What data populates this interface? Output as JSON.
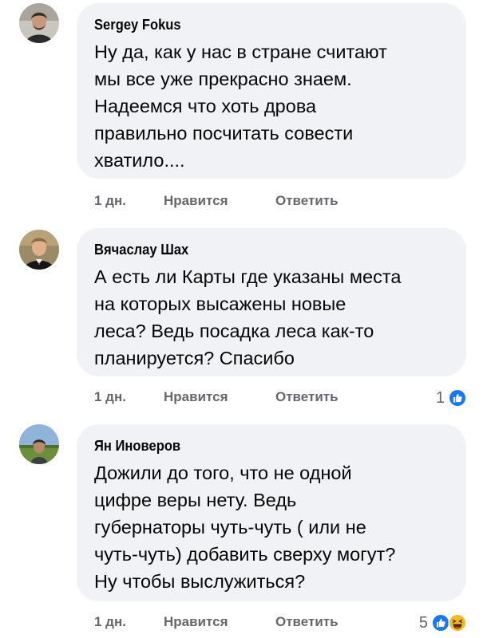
{
  "comments": [
    {
      "author": "Sergey Fokus",
      "text": "Ну да, как у нас в стране считают\nмы все уже прекрасно знаем.\nНадеемся что хоть дрова\nправильно посчитать совести\nхватило....",
      "time": "1 дн.",
      "like_label": "Нравится",
      "reply_label": "Ответить",
      "reaction_count": "",
      "reactions": []
    },
    {
      "author": "Вячаслау Шах",
      "text": "А есть ли Карты где указаны места\nна которых высажены новые\nлеса? Ведь посадка леса как-то\nпланируется? Спасибо",
      "time": "1 дн.",
      "like_label": "Нравится",
      "reply_label": "Ответить",
      "reaction_count": "1",
      "reactions": [
        "like-icon"
      ]
    },
    {
      "author": "Ян Иноверов",
      "text": "Дожили до того, что не одной\nцифре веры нету. Ведь\nгубернаторы чуть-чуть ( или не\nчуть-чуть) добавить сверху могут?\nНу чтобы выслужиться?",
      "time": "1 дн.",
      "like_label": "Нравится",
      "reply_label": "Ответить",
      "reaction_count": "5",
      "reactions": [
        "like-icon",
        "haha-icon"
      ]
    }
  ],
  "colors": {
    "bubble": "#f0f2f5",
    "meta_text": "#65676b",
    "like_blue": "#1877f2",
    "haha_yellow": "#f7b928"
  }
}
